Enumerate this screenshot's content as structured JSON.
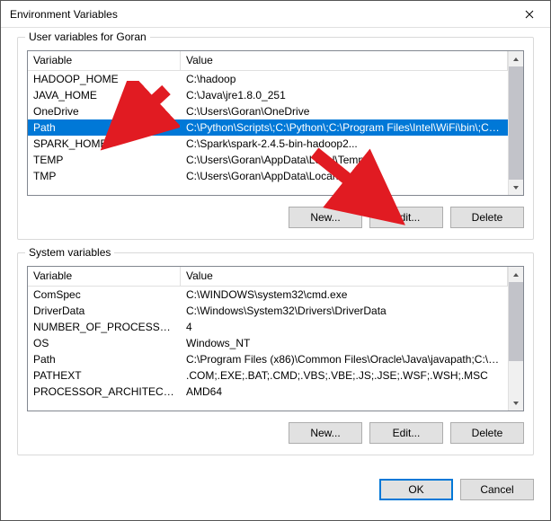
{
  "window": {
    "title": "Environment Variables"
  },
  "user_section": {
    "label": "User variables for Goran",
    "header_var": "Variable",
    "header_val": "Value",
    "rows": [
      {
        "name": "HADOOP_HOME",
        "value": "C:\\hadoop"
      },
      {
        "name": "JAVA_HOME",
        "value": "C:\\Java\\jre1.8.0_251"
      },
      {
        "name": "OneDrive",
        "value": "C:\\Users\\Goran\\OneDrive"
      },
      {
        "name": "Path",
        "value": "C:\\Python\\Scripts\\;C:\\Python\\;C:\\Program Files\\Intel\\WiFi\\bin\\;C:\\...",
        "selected": true
      },
      {
        "name": "SPARK_HOME",
        "value": "C:\\Spark\\spark-2.4.5-bin-hadoop2..."
      },
      {
        "name": "TEMP",
        "value": "C:\\Users\\Goran\\AppData\\Local\\Temp"
      },
      {
        "name": "TMP",
        "value": "C:\\Users\\Goran\\AppData\\Local\\Temp"
      }
    ],
    "btn_new": "New...",
    "btn_edit": "Edit...",
    "btn_delete": "Delete"
  },
  "system_section": {
    "label": "System variables",
    "header_var": "Variable",
    "header_val": "Value",
    "rows": [
      {
        "name": "ComSpec",
        "value": "C:\\WINDOWS\\system32\\cmd.exe"
      },
      {
        "name": "DriverData",
        "value": "C:\\Windows\\System32\\Drivers\\DriverData"
      },
      {
        "name": "NUMBER_OF_PROCESSORS",
        "value": "4"
      },
      {
        "name": "OS",
        "value": "Windows_NT"
      },
      {
        "name": "Path",
        "value": "C:\\Program Files (x86)\\Common Files\\Oracle\\Java\\javapath;C:\\WIN..."
      },
      {
        "name": "PATHEXT",
        "value": ".COM;.EXE;.BAT;.CMD;.VBS;.VBE;.JS;.JSE;.WSF;.WSH;.MSC"
      },
      {
        "name": "PROCESSOR_ARCHITECTURE",
        "value": "AMD64"
      }
    ],
    "btn_new": "New...",
    "btn_edit": "Edit...",
    "btn_delete": "Delete"
  },
  "footer": {
    "ok": "OK",
    "cancel": "Cancel"
  },
  "annotations": {
    "arrow_color": "#e11b22"
  }
}
